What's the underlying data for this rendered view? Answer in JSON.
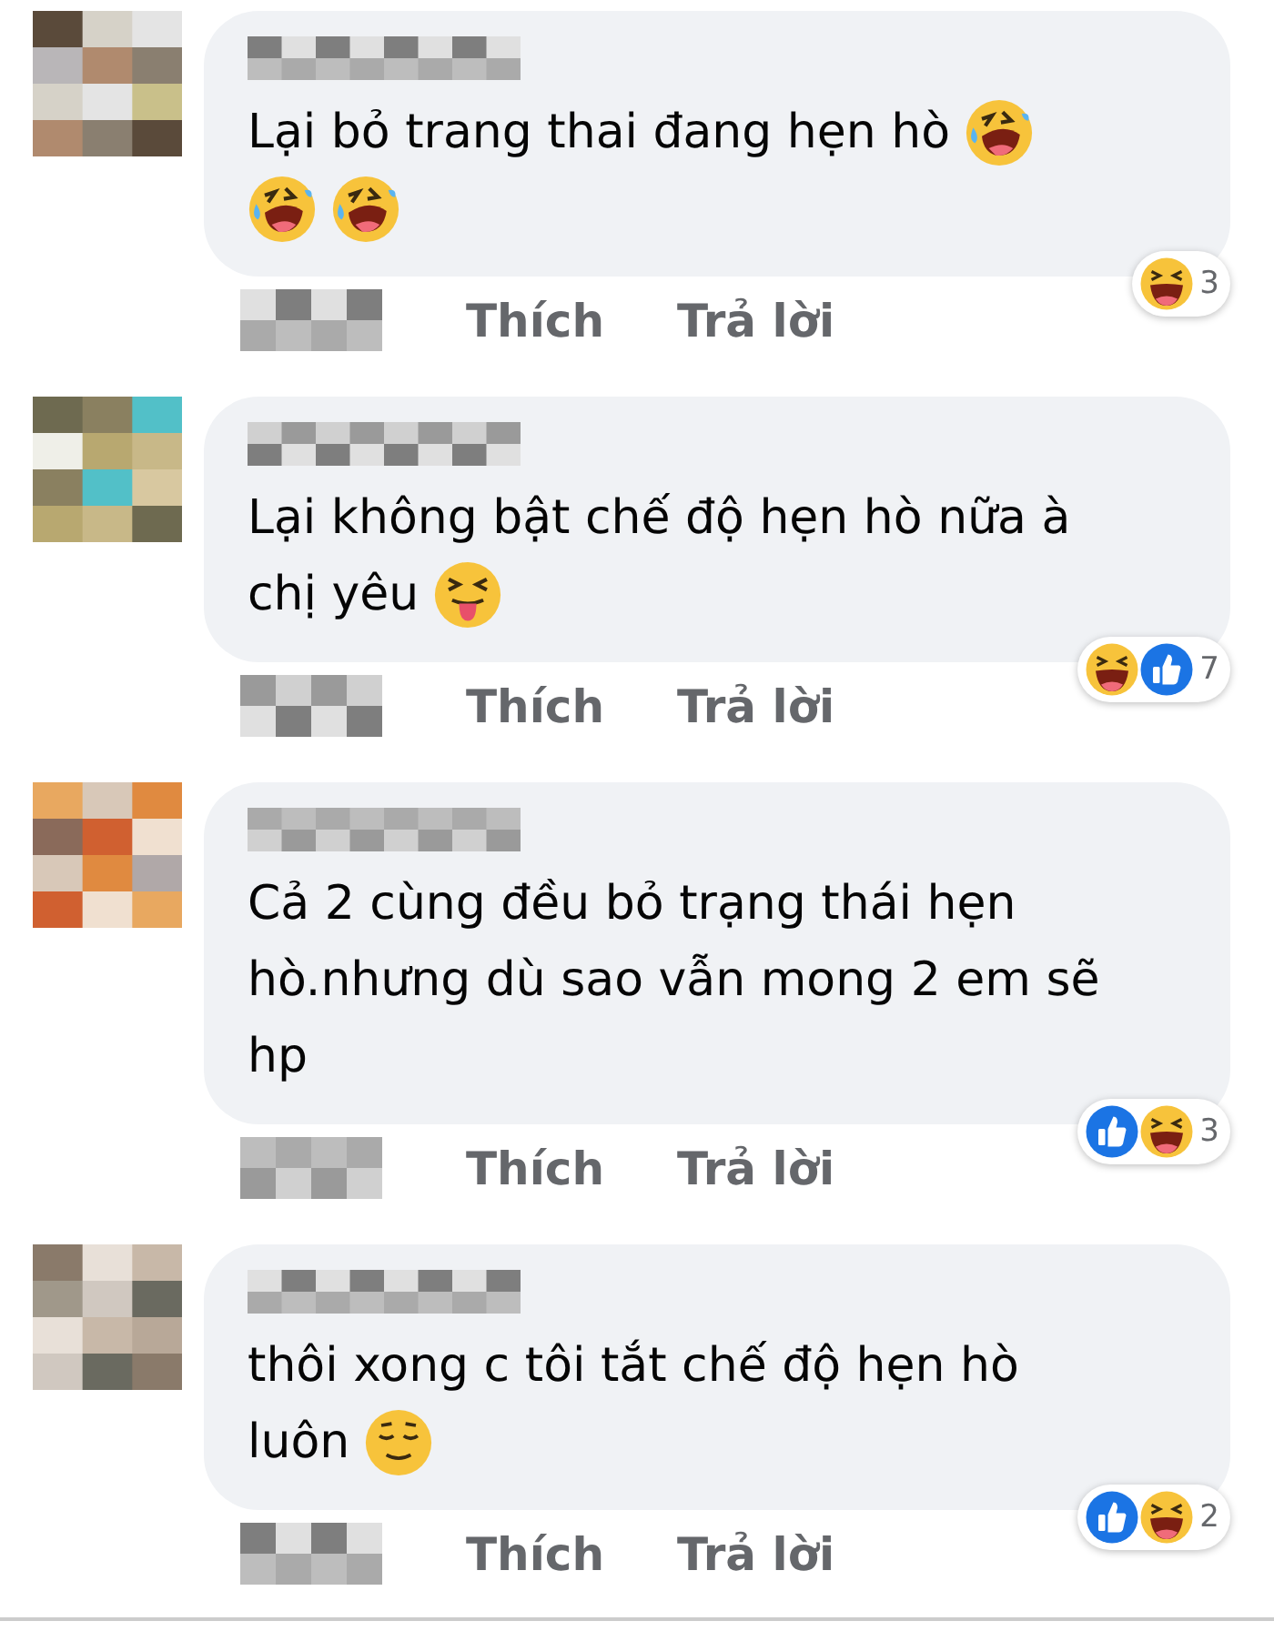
{
  "comments": [
    {
      "lines": [
        [
          {
            "kind": "text",
            "text": "Lại bỏ trang thai đang hẹn hò"
          },
          {
            "kind": "rofl"
          }
        ],
        [
          {
            "kind": "rofl"
          },
          {
            "kind": "rofl"
          }
        ]
      ],
      "actions": [
        "Thích",
        "Trả lời"
      ],
      "reactions": [
        {
          "kind": "haha"
        }
      ],
      "reaction_count": "3"
    },
    {
      "lines": [
        [
          {
            "kind": "text",
            "text": "Lại không bật chế độ hẹn hò nữa à"
          }
        ],
        [
          {
            "kind": "text",
            "text": "chị yêu"
          },
          {
            "kind": "tongue"
          }
        ]
      ],
      "actions": [
        "Thích",
        "Trả lời"
      ],
      "reactions": [
        {
          "kind": "haha"
        },
        {
          "kind": "like"
        }
      ],
      "reaction_count": "7"
    },
    {
      "lines": [
        [
          {
            "kind": "text",
            "text": "Cả 2 cùng đều bỏ trạng thái hẹn"
          }
        ],
        [
          {
            "kind": "text",
            "text": "hò.nhưng dù sao vẫn mong 2 em sẽ"
          }
        ],
        [
          {
            "kind": "text",
            "text": "hp"
          }
        ]
      ],
      "actions": [
        "Thích",
        "Trả lời"
      ],
      "reactions": [
        {
          "kind": "like"
        },
        {
          "kind": "haha"
        }
      ],
      "reaction_count": "3"
    },
    {
      "lines": [
        [
          {
            "kind": "text",
            "text": "thôi xong c tôi tắt chế độ hẹn hò"
          }
        ],
        [
          {
            "kind": "text",
            "text": "luôn"
          },
          {
            "kind": "relieved"
          }
        ]
      ],
      "actions": [
        "Thích",
        "Trả lời"
      ],
      "reactions": [
        {
          "kind": "like"
        },
        {
          "kind": "haha"
        }
      ],
      "reaction_count": "2"
    }
  ]
}
